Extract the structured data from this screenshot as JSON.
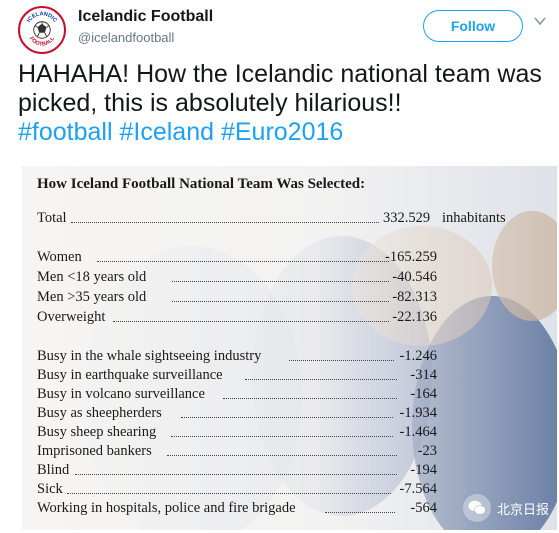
{
  "header": {
    "display_name": "Icelandic Football",
    "handle": "@icelandfootball",
    "follow_label": "Follow",
    "avatar_text": "ICELANDIC FOOTBALL"
  },
  "tweet": {
    "text": "HAHAHA! How the Icelandic national team was picked, this is absolutely hilarious!!",
    "hashtags": [
      "#football",
      "#Iceland",
      "#Euro2016"
    ]
  },
  "image": {
    "title": "How Iceland Football National Team Was Selected:",
    "total": {
      "label": "Total",
      "value": "332.529",
      "unit": "inhabitants"
    },
    "group1": [
      {
        "label": "Women",
        "value": "-165.259"
      },
      {
        "label": "Men <18 years old",
        "value": "-40.546"
      },
      {
        "label": "Men >35 years old",
        "value": "-82.313"
      },
      {
        "label": "Overweight",
        "value": "-22.136"
      }
    ],
    "group2": [
      {
        "label": "Busy in the whale sightseeing industry",
        "value": "-1.246"
      },
      {
        "label": "Busy in earthquake surveillance",
        "value": "-314"
      },
      {
        "label": "Busy in volcano surveillance",
        "value": "-164"
      },
      {
        "label": "Busy as sheepherders",
        "value": "-1.934"
      },
      {
        "label": "Busy sheep shearing",
        "value": "-1.464"
      },
      {
        "label": "Imprisoned bankers",
        "value": "-23"
      },
      {
        "label": "Blind",
        "value": "-194"
      },
      {
        "label": "Sick",
        "value": "-7.564"
      },
      {
        "label": "Working in hospitals, police and fire brigade",
        "value": "-564"
      }
    ],
    "watermark": "北京日报"
  },
  "colors": {
    "link": "#1da1f2",
    "text": "#14171a",
    "muted": "#657786",
    "avatar_red": "#c8102e",
    "avatar_blue": "#003897"
  }
}
